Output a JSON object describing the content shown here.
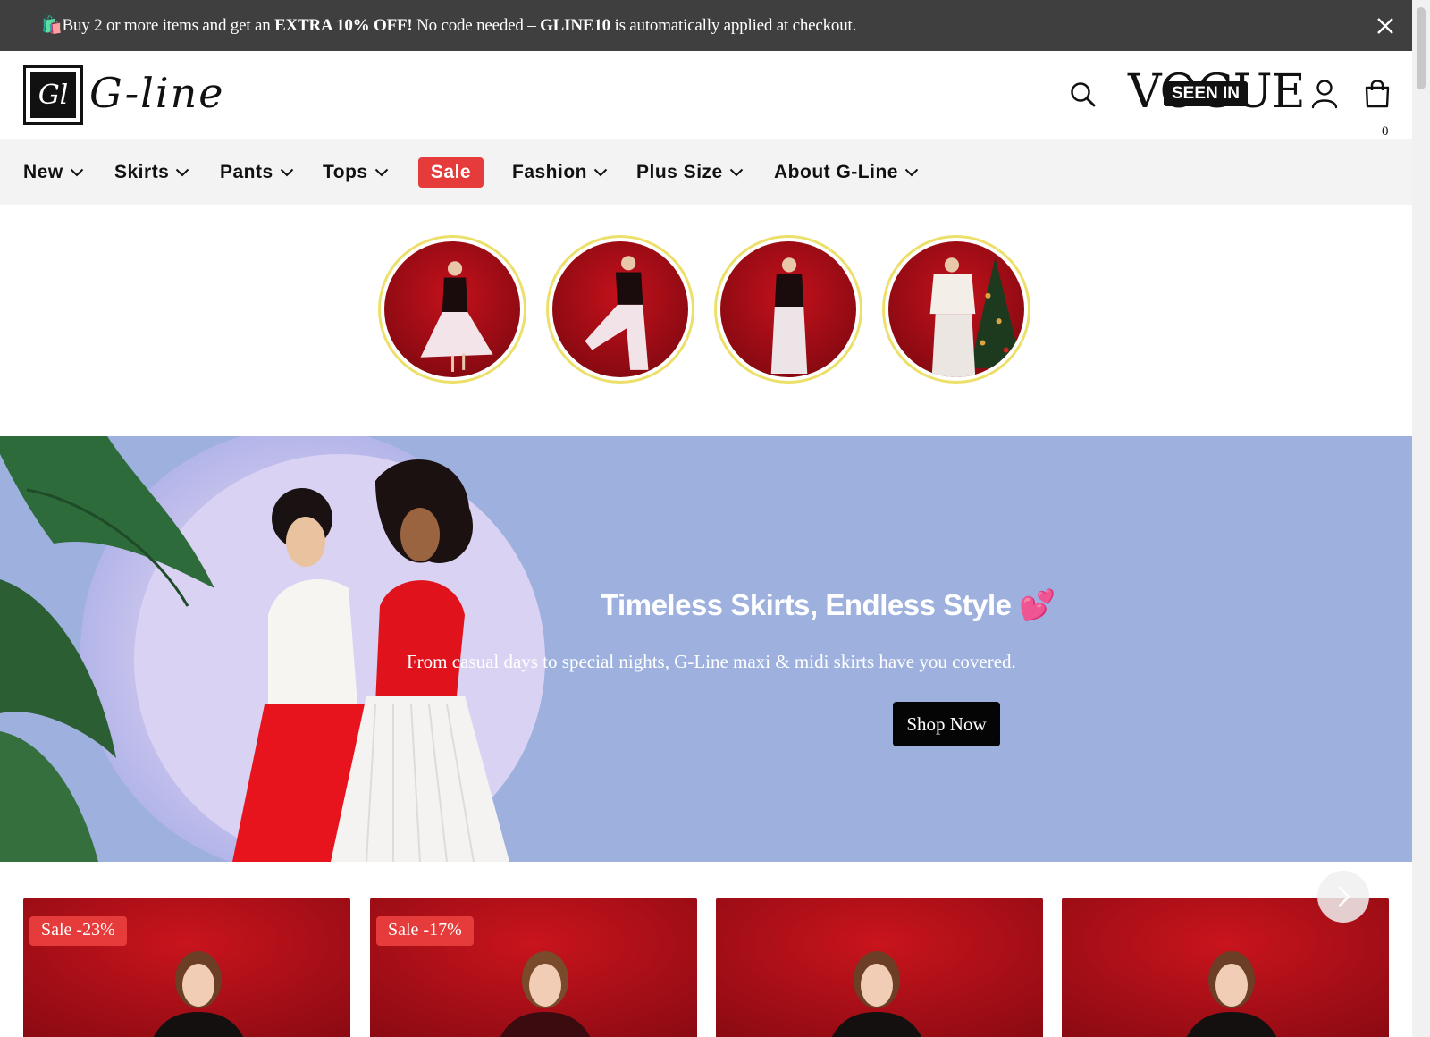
{
  "announcement": {
    "icon": "shopping-bag-emoji",
    "emoji": "🛍️",
    "text_1": "Buy 2 or more items and get an ",
    "text_bold_1": "EXTRA 10% OFF!",
    "text_2": " No code needed – ",
    "text_bold_2": "GLINE10",
    "text_3": " is automatically applied at checkout."
  },
  "header": {
    "logo_mark": "Gl",
    "logo_text": "G-line",
    "vogue_word": "VOGUE",
    "vogue_badge": "SEEN IN",
    "cart_count": "0"
  },
  "nav": {
    "items": [
      {
        "label": "New"
      },
      {
        "label": "Skirts"
      },
      {
        "label": "Pants"
      },
      {
        "label": "Tops"
      },
      {
        "label": "Sale"
      },
      {
        "label": "Fashion"
      },
      {
        "label": "Plus Size"
      },
      {
        "label": "About G-Line"
      }
    ]
  },
  "hero": {
    "title": "Timeless Skirts, Endless Style",
    "title_emoji": "💕",
    "subtitle": "From casual days to special nights, G-Line maxi & midi skirts have you covered.",
    "cta": "Shop Now"
  },
  "products": {
    "cards": [
      {
        "badge": "Sale -23%"
      },
      {
        "badge": "Sale -17%"
      },
      {
        "badge": ""
      },
      {
        "badge": ""
      }
    ]
  },
  "colors": {
    "announcement_bg": "#3f3f3f",
    "nav_bg": "#f3f3f3",
    "sale_red": "#e63b3b",
    "hero_bg": "#9db0de",
    "story_ring": "#ece06a",
    "product_red": "#b3111a"
  }
}
